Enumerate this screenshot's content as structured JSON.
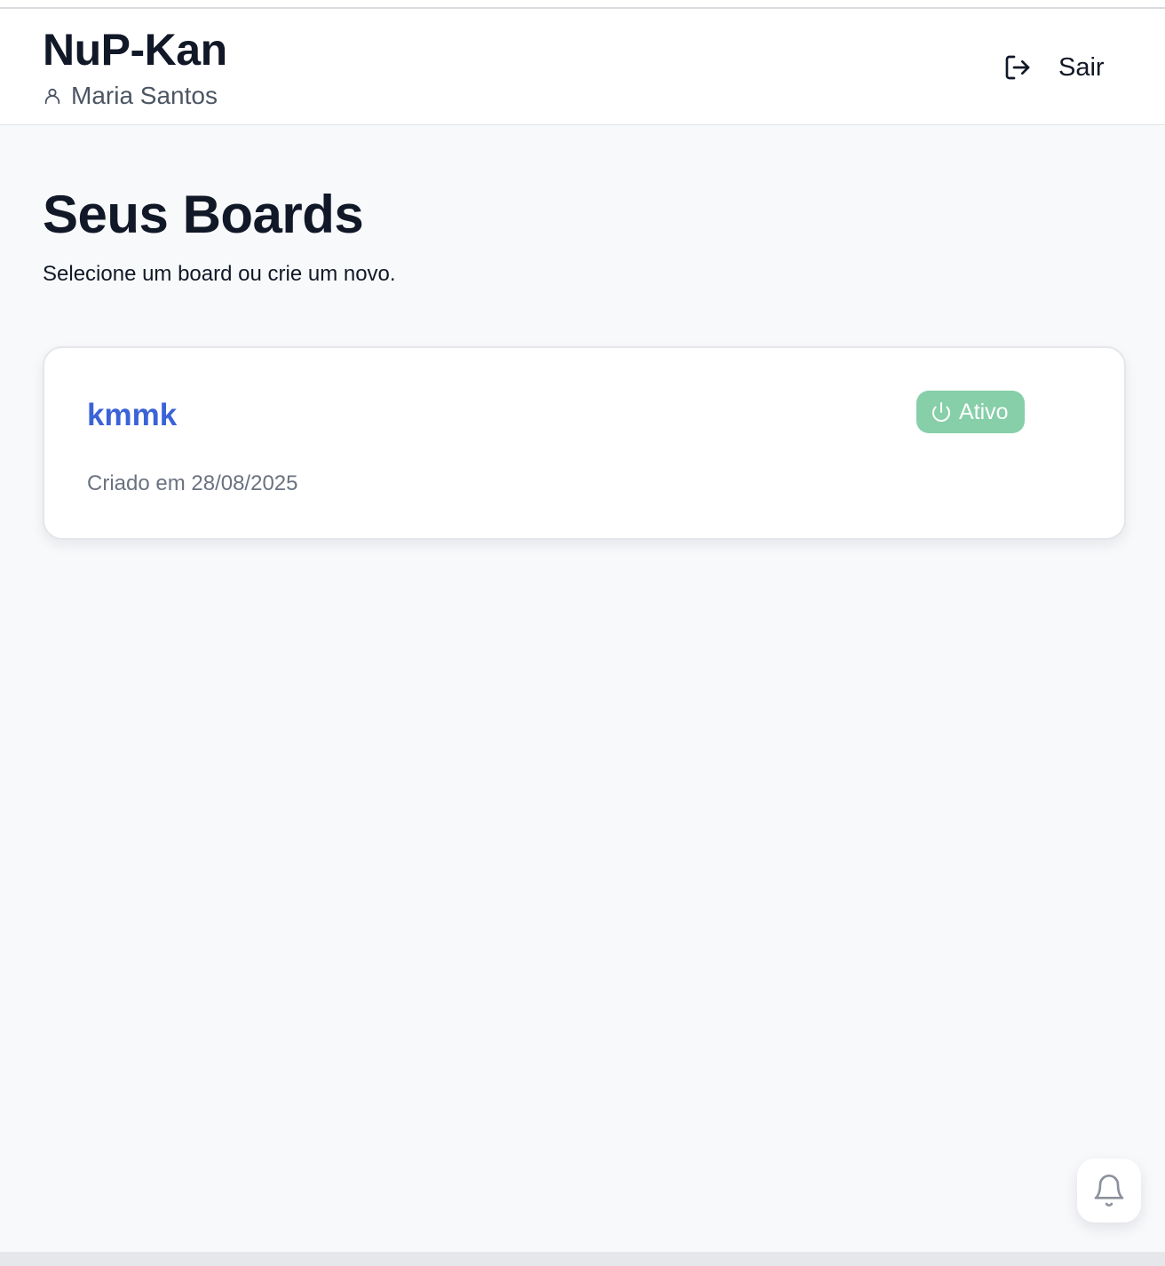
{
  "header": {
    "app_title": "NuP-Kan",
    "user_name": "Maria Santos",
    "user_icon": "user-icon",
    "logout_label": "Sair",
    "logout_icon": "logout-icon"
  },
  "main": {
    "title": "Seus Boards",
    "subtitle": "Selecione um board ou crie um novo.",
    "boards": [
      {
        "name": "kmmk",
        "created": "Criado em 28/08/2025",
        "status": "Ativo",
        "status_icon": "power-icon",
        "status_color": "#86cfa8"
      }
    ]
  },
  "notifications": {
    "icon": "bell-icon"
  },
  "colors": {
    "accent": "#3b63d8",
    "page_background": "#f8f9fb",
    "active_badge": "#86cfa8"
  }
}
